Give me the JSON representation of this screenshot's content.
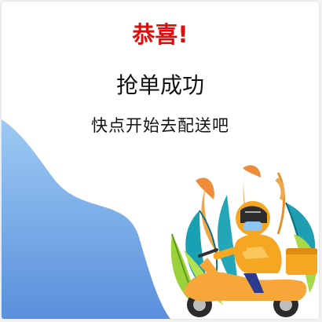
{
  "dialog": {
    "congrats": "恭喜!",
    "title": "抢单成功",
    "subtitle": "快点开始去配送吧"
  },
  "colors": {
    "congrats": "#e10d0d",
    "wave_top": "#8fc4f2",
    "wave_bottom": "#5b93dc",
    "rider_helmet": "#f5a623",
    "scooter": "#f7a63a",
    "leaf_teal": "#1f9db1",
    "leaf_green": "#9bd13b"
  },
  "icons": {
    "illustration": "delivery-rider-on-scooter"
  }
}
